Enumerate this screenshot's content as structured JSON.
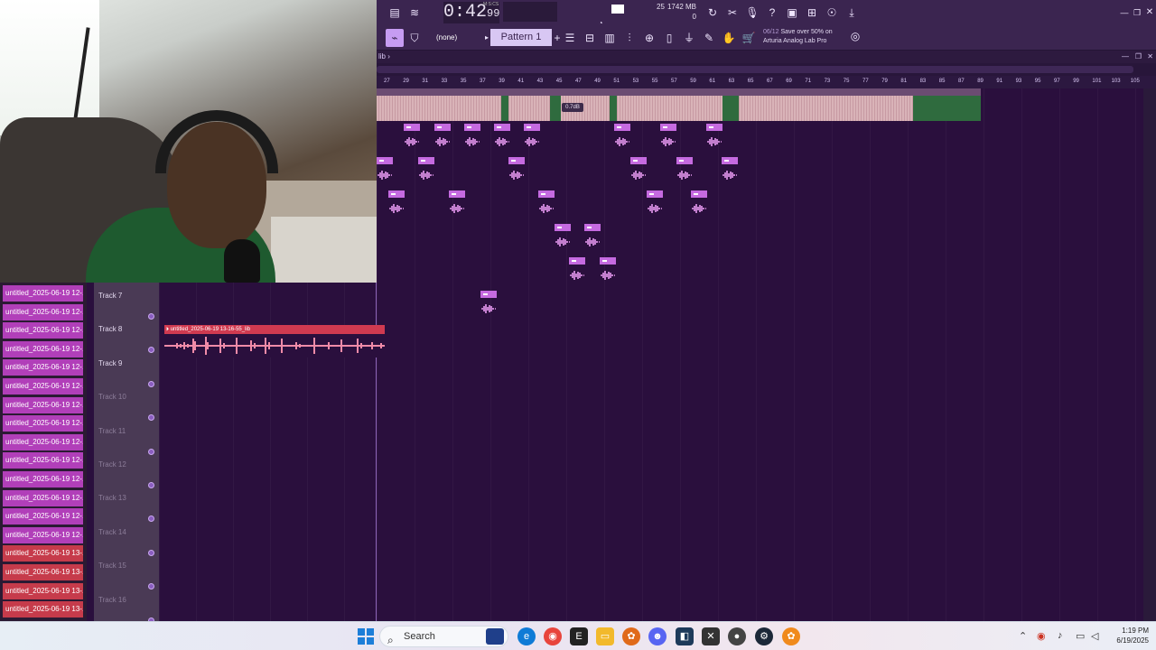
{
  "toolbar": {
    "time": "0:42",
    "time_frac": "99",
    "time_label": "M:S:CS",
    "cpu": "25",
    "memory": "1742 MB",
    "voices": "0",
    "pattern": "Pattern 1",
    "none_label": "(none)",
    "hint_counter": "06/12",
    "hint_text": "Save over 50% on",
    "hint_text2": "Arturia Analog Lab Pro"
  },
  "playlist": {
    "title": "lib",
    "ruler": [
      "27",
      "29",
      "31",
      "33",
      "35",
      "37",
      "39",
      "41",
      "43",
      "45",
      "47",
      "49",
      "51",
      "53",
      "55",
      "57",
      "59",
      "61",
      "63",
      "65",
      "67",
      "69",
      "71",
      "73",
      "75",
      "77",
      "79",
      "81",
      "83",
      "85",
      "87",
      "89",
      "91",
      "93",
      "95",
      "97",
      "99",
      "101",
      "103",
      "105"
    ],
    "db_label": "0.7dB",
    "track8_clip_label": "untitled_2025-06-19 13-16-55_lib"
  },
  "clips": [
    {
      "label": "untitled_2025-06-19 12-...",
      "color": "p"
    },
    {
      "label": "untitled_2025-06-19 12-...",
      "color": "p"
    },
    {
      "label": "untitled_2025-06-19 12-...",
      "color": "p"
    },
    {
      "label": "untitled_2025-06-19 12-...",
      "color": "p"
    },
    {
      "label": "untitled_2025-06-19 12-...",
      "color": "p"
    },
    {
      "label": "untitled_2025-06-19 12-...",
      "color": "p"
    },
    {
      "label": "untitled_2025-06-19 12-...",
      "color": "p"
    },
    {
      "label": "untitled_2025-06-19 12-...",
      "color": "p"
    },
    {
      "label": "untitled_2025-06-19 12-...",
      "color": "p"
    },
    {
      "label": "untitled_2025-06-19 12-...",
      "color": "p"
    },
    {
      "label": "untitled_2025-06-19 12-...",
      "color": "p"
    },
    {
      "label": "untitled_2025-06-19 12-...",
      "color": "p"
    },
    {
      "label": "untitled_2025-06-19 12-...",
      "color": "p"
    },
    {
      "label": "untitled_2025-06-19 12-...",
      "color": "p"
    },
    {
      "label": "untitled_2025-06-19 13-...",
      "color": "r"
    },
    {
      "label": "untitled_2025-06-19 13-...",
      "color": "r"
    },
    {
      "label": "untitled_2025-06-19 13-...",
      "color": "r"
    },
    {
      "label": "untitled_2025-06-19 13-...",
      "color": "r"
    }
  ],
  "tracks": [
    {
      "label": "Track 7",
      "dim": false
    },
    {
      "label": "Track 8",
      "dim": false
    },
    {
      "label": "Track 9",
      "dim": false
    },
    {
      "label": "Track 10",
      "dim": true
    },
    {
      "label": "Track 11",
      "dim": true
    },
    {
      "label": "Track 12",
      "dim": true
    },
    {
      "label": "Track 13",
      "dim": true
    },
    {
      "label": "Track 14",
      "dim": true
    },
    {
      "label": "Track 15",
      "dim": true
    },
    {
      "label": "Track 16",
      "dim": true
    }
  ],
  "taskbar": {
    "search_placeholder": "Search",
    "time": "1:19 PM",
    "date": "6/19/2025"
  }
}
